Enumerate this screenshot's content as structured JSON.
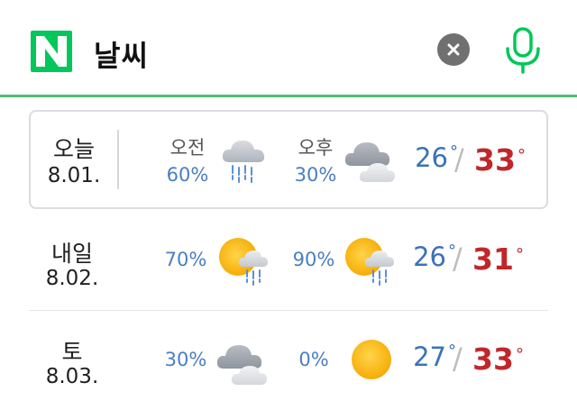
{
  "search": {
    "brand_letter": "N",
    "query": "날씨"
  },
  "colors": {
    "brand_green": "#03c75a",
    "probability_blue": "#4a7fc1",
    "low_temp_blue": "#3b72b8",
    "high_temp_red": "#c0262a"
  },
  "forecast": [
    {
      "day": "오늘",
      "date": "8.01.",
      "am_label": "오전",
      "am_prob": "60%",
      "am_icon": "cloud-rain-icon",
      "pm_label": "오후",
      "pm_prob": "30%",
      "pm_icon": "cloudy-icon",
      "low": "26",
      "high": "33",
      "degree_symbol": "°"
    },
    {
      "day": "내일",
      "date": "8.02.",
      "am_prob": "70%",
      "am_icon": "sun-cloud-rain-icon",
      "pm_prob": "90%",
      "pm_icon": "sun-cloud-rain-icon",
      "low": "26",
      "high": "31",
      "degree_symbol": "°"
    },
    {
      "day": "토",
      "date": "8.03.",
      "am_prob": "30%",
      "am_icon": "cloudy-icon",
      "pm_prob": "0%",
      "pm_icon": "sunny-icon",
      "low": "27",
      "high": "33",
      "degree_symbol": "°"
    }
  ]
}
